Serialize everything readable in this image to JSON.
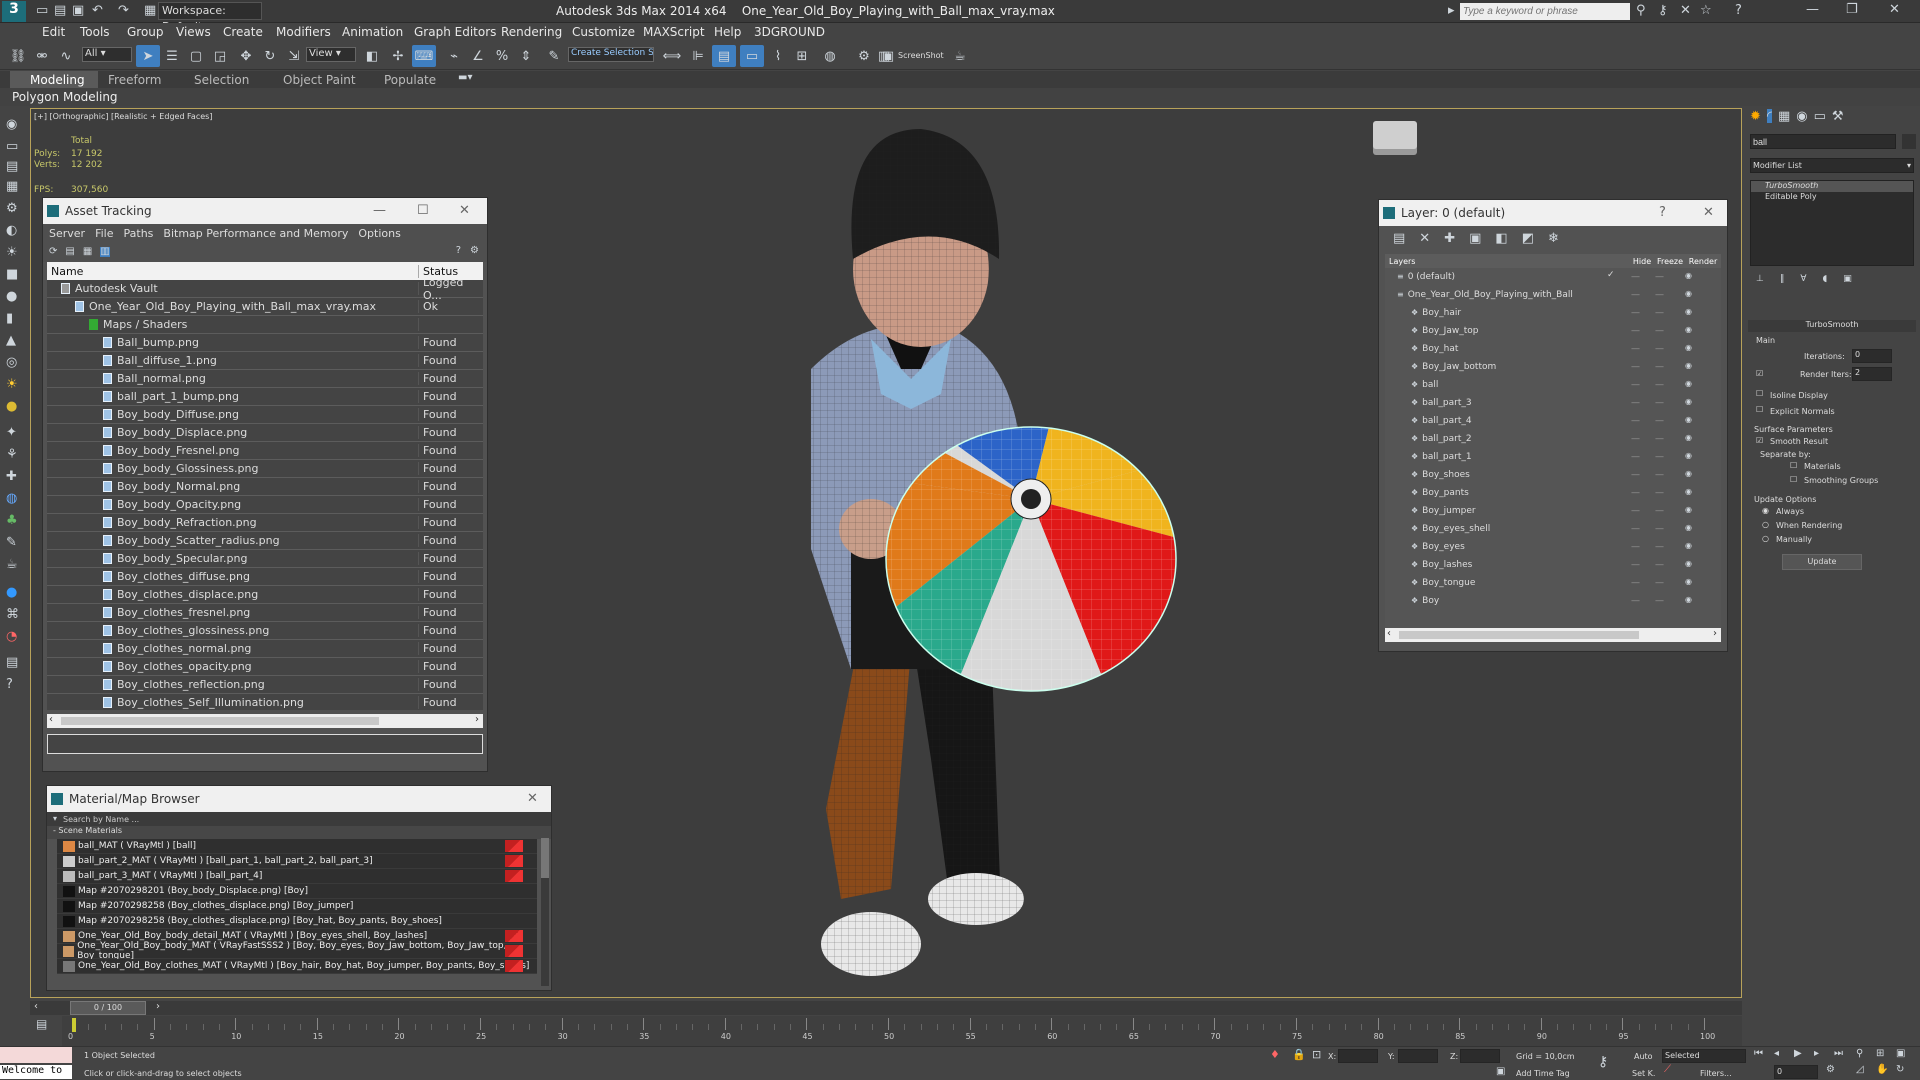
{
  "app": {
    "title": "Autodesk 3ds Max  2014 x64",
    "filename": "One_Year_Old_Boy_Playing_with_Ball_max_vray.max",
    "workspace": "Workspace: Default",
    "search_placeholder": "Type a keyword or phrase"
  },
  "menu": [
    "Edit",
    "Tools",
    "Group",
    "Views",
    "Create",
    "Modifiers",
    "Animation",
    "Graph Editors",
    "Rendering",
    "Customize",
    "MAXScript",
    "Help",
    "3DGROUND"
  ],
  "toolbar": {
    "filter": "All",
    "ref_coord": "View",
    "named_sel": "Create Selection Se",
    "screenshot": "ScreenShot"
  },
  "ribbon": {
    "tabs": [
      "Modeling",
      "Freeform",
      "Selection",
      "Object Paint",
      "Populate"
    ],
    "sub": "Polygon Modeling"
  },
  "viewport": {
    "label": "[+] [Orthographic] [Realistic + Edged Faces]",
    "stats_header": "Total",
    "polys_label": "Polys:",
    "polys": "17 192",
    "verts_label": "Verts:",
    "verts": "12 202",
    "fps_label": "FPS:",
    "fps": "307,560"
  },
  "asset_tracking": {
    "title": "Asset Tracking",
    "menu": [
      "Server",
      "File",
      "Paths",
      "Bitmap Performance and Memory",
      "Options"
    ],
    "col_name": "Name",
    "col_status": "Status",
    "rows": [
      {
        "name": "Autodesk Vault",
        "status": "Logged O...",
        "indent": 1
      },
      {
        "name": "One_Year_Old_Boy_Playing_with_Ball_max_vray.max",
        "status": "Ok",
        "indent": 2
      },
      {
        "name": "Maps / Shaders",
        "status": "",
        "indent": 3
      },
      {
        "name": "Ball_bump.png",
        "status": "Found",
        "indent": 4
      },
      {
        "name": "Ball_diffuse_1.png",
        "status": "Found",
        "indent": 4
      },
      {
        "name": "Ball_normal.png",
        "status": "Found",
        "indent": 4
      },
      {
        "name": "ball_part_1_bump.png",
        "status": "Found",
        "indent": 4
      },
      {
        "name": "Boy_body_Diffuse.png",
        "status": "Found",
        "indent": 4
      },
      {
        "name": "Boy_body_Displace.png",
        "status": "Found",
        "indent": 4
      },
      {
        "name": "Boy_body_Fresnel.png",
        "status": "Found",
        "indent": 4
      },
      {
        "name": "Boy_body_Glossiness.png",
        "status": "Found",
        "indent": 4
      },
      {
        "name": "Boy_body_Normal.png",
        "status": "Found",
        "indent": 4
      },
      {
        "name": "Boy_body_Opacity.png",
        "status": "Found",
        "indent": 4
      },
      {
        "name": "Boy_body_Refraction.png",
        "status": "Found",
        "indent": 4
      },
      {
        "name": "Boy_body_Scatter_radius.png",
        "status": "Found",
        "indent": 4
      },
      {
        "name": "Boy_body_Specular.png",
        "status": "Found",
        "indent": 4
      },
      {
        "name": "Boy_clothes_diffuse.png",
        "status": "Found",
        "indent": 4
      },
      {
        "name": "Boy_clothes_displace.png",
        "status": "Found",
        "indent": 4
      },
      {
        "name": "Boy_clothes_fresnel.png",
        "status": "Found",
        "indent": 4
      },
      {
        "name": "Boy_clothes_glossiness.png",
        "status": "Found",
        "indent": 4
      },
      {
        "name": "Boy_clothes_normal.png",
        "status": "Found",
        "indent": 4
      },
      {
        "name": "Boy_clothes_opacity.png",
        "status": "Found",
        "indent": 4
      },
      {
        "name": "Boy_clothes_reflection.png",
        "status": "Found",
        "indent": 4
      },
      {
        "name": "Boy_clothes_Self_Illumination.png",
        "status": "Found",
        "indent": 4
      }
    ]
  },
  "material_browser": {
    "title": "Material/Map Browser",
    "search_placeholder": "Search by Name ...",
    "group": "- Scene Materials",
    "items": [
      {
        "text": "ball_MAT  ( VRayMtl )  [ball]",
        "swatch": "#d84",
        "red": true
      },
      {
        "text": "ball_part_2_MAT  ( VRayMtl )  [ball_part_1, ball_part_2, ball_part_3]",
        "swatch": "#ccc",
        "red": true
      },
      {
        "text": "ball_part_3_MAT  ( VRayMtl )  [ball_part_4]",
        "swatch": "#bbb",
        "red": true
      },
      {
        "text": "Map #2070298201 (Boy_body_Displace.png)  [Boy]",
        "swatch": "#111",
        "red": false
      },
      {
        "text": "Map #2070298258 (Boy_clothes_displace.png)  [Boy_jumper]",
        "swatch": "#111",
        "red": false
      },
      {
        "text": "Map #2070298258 (Boy_clothes_displace.png)  [Boy_hat, Boy_pants, Boy_shoes]",
        "swatch": "#111",
        "red": false
      },
      {
        "text": "One_Year_Old_Boy_body_detail_MAT  ( VRayMtl )  [Boy_eyes_shell, Boy_lashes]",
        "swatch": "#c96",
        "red": true
      },
      {
        "text": "One_Year_Old_Boy_body_MAT  ( VRayFastSSS2 )  [Boy, Boy_eyes, Boy_Jaw_bottom, Boy_Jaw_top, Boy_tongue]",
        "swatch": "#c96",
        "red": true
      },
      {
        "text": "One_Year_Old_Boy_clothes_MAT  ( VRayMtl )  [Boy_hair, Boy_hat, Boy_jumper, Boy_pants, Boy_shoes]",
        "swatch": "#777",
        "red": true
      }
    ]
  },
  "layer_panel": {
    "title": "Layer: 0 (default)",
    "col_layers": "Layers",
    "col_hide": "Hide",
    "col_freeze": "Freeze",
    "col_render": "Render",
    "layers": [
      {
        "name": "0 (default)",
        "indent": 1
      },
      {
        "name": "One_Year_Old_Boy_Playing_with_Ball",
        "indent": 1
      },
      {
        "name": "Boy_hair",
        "indent": 2
      },
      {
        "name": "Boy_Jaw_top",
        "indent": 2
      },
      {
        "name": "Boy_hat",
        "indent": 2
      },
      {
        "name": "Boy_Jaw_bottom",
        "indent": 2
      },
      {
        "name": "ball",
        "indent": 2
      },
      {
        "name": "ball_part_3",
        "indent": 2
      },
      {
        "name": "ball_part_4",
        "indent": 2
      },
      {
        "name": "ball_part_2",
        "indent": 2
      },
      {
        "name": "ball_part_1",
        "indent": 2
      },
      {
        "name": "Boy_shoes",
        "indent": 2
      },
      {
        "name": "Boy_pants",
        "indent": 2
      },
      {
        "name": "Boy_jumper",
        "indent": 2
      },
      {
        "name": "Boy_eyes_shell",
        "indent": 2
      },
      {
        "name": "Boy_eyes",
        "indent": 2
      },
      {
        "name": "Boy_lashes",
        "indent": 2
      },
      {
        "name": "Boy_tongue",
        "indent": 2
      },
      {
        "name": "Boy",
        "indent": 2
      }
    ]
  },
  "command_panel": {
    "name_field": "ball",
    "modifier_list": "Modifier List",
    "stack": [
      "TurboSmooth",
      "Editable Poly"
    ],
    "rollout_title": "TurboSmooth",
    "main": "Main",
    "iterations_label": "Iterations:",
    "iterations": "0",
    "render_iters_label": "Render Iters:",
    "render_iters": "2",
    "isoline": "Isoline Display",
    "explicit": "Explicit Normals",
    "surface": "Surface Parameters",
    "smooth_result": "Smooth Result",
    "separate_by": "Separate by:",
    "materials": "Materials",
    "smoothing_groups": "Smoothing Groups",
    "update_options": "Update Options",
    "always": "Always",
    "when_rendering": "When Rendering",
    "manually": "Manually",
    "update_btn": "Update"
  },
  "timeline": {
    "frame": "0 / 100",
    "ticks": [
      "0",
      "5",
      "10",
      "15",
      "20",
      "25",
      "30",
      "35",
      "40",
      "45",
      "50",
      "55",
      "60",
      "65",
      "70",
      "75",
      "80",
      "85",
      "90",
      "95",
      "100"
    ]
  },
  "status": {
    "welcome": "Welcome to",
    "objects": "1 Object Selected",
    "prompt": "Click or click-and-drag to select objects",
    "x_label": "X:",
    "y_label": "Y:",
    "z_label": "Z:",
    "grid": "Grid = 10,0cm",
    "add_time_tag": "Add Time Tag",
    "auto": "Auto",
    "set_key": "Set K.",
    "selected": "Selected",
    "filters": "Filters...",
    "frame_field": "0"
  }
}
